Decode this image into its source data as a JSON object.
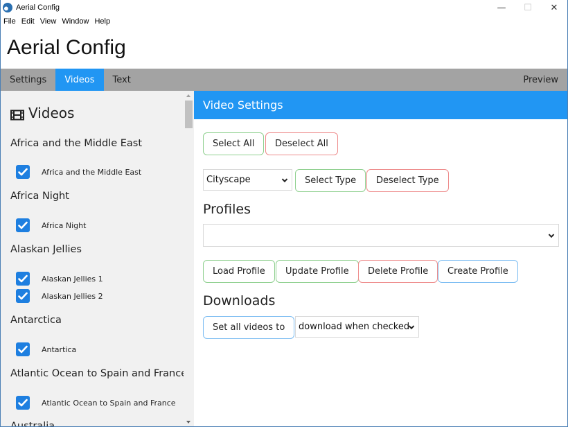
{
  "window": {
    "title": "Aerial Config",
    "controls": {
      "minimize": "—",
      "maximize": "☐",
      "close": "✕"
    }
  },
  "menu": [
    "File",
    "Edit",
    "View",
    "Window",
    "Help"
  ],
  "app_title": "Aerial Config",
  "nav": {
    "tabs": [
      {
        "label": "Settings",
        "active": false
      },
      {
        "label": "Videos",
        "active": true
      },
      {
        "label": "Text",
        "active": false
      }
    ],
    "right_link": "Preview"
  },
  "sidebar": {
    "title": "Videos",
    "title_icon": "film-icon",
    "groups": [
      {
        "heading": "Africa and the Middle East",
        "videos": [
          {
            "label": "Africa and the Middle East",
            "checked": true
          }
        ]
      },
      {
        "heading": "Africa Night",
        "videos": [
          {
            "label": "Africa Night",
            "checked": true
          }
        ]
      },
      {
        "heading": "Alaskan Jellies",
        "videos": [
          {
            "label": "Alaskan Jellies 1",
            "checked": true
          },
          {
            "label": "Alaskan Jellies 2",
            "checked": true
          }
        ]
      },
      {
        "heading": "Antarctica",
        "videos": [
          {
            "label": "Antartica",
            "checked": true
          }
        ]
      },
      {
        "heading": "Atlantic Ocean to Spain and France",
        "videos": [
          {
            "label": "Atlantic Ocean to Spain and France",
            "checked": true
          }
        ]
      },
      {
        "heading": "Australia",
        "videos": []
      }
    ]
  },
  "main": {
    "header": "Video Settings",
    "select_all": "Select All",
    "deselect_all": "Deselect All",
    "type_select": {
      "value": "Cityscape"
    },
    "select_type": "Select Type",
    "deselect_type": "Deselect Type",
    "profiles": {
      "title": "Profiles",
      "select_value": "",
      "load": "Load Profile",
      "update": "Update Profile",
      "delete": "Delete Profile",
      "create": "Create Profile"
    },
    "downloads": {
      "title": "Downloads",
      "set_all": "Set all videos to",
      "select_value": "download when checked"
    }
  },
  "colors": {
    "accent": "#2196f3",
    "nav_bg": "#a3a3a3",
    "sidebar_bg": "#f1f1f1",
    "checkbox": "#1e7fe0",
    "green_border": "#8fd08f",
    "red_border": "#ee8c8c",
    "blue_border": "#7bbcf2"
  }
}
